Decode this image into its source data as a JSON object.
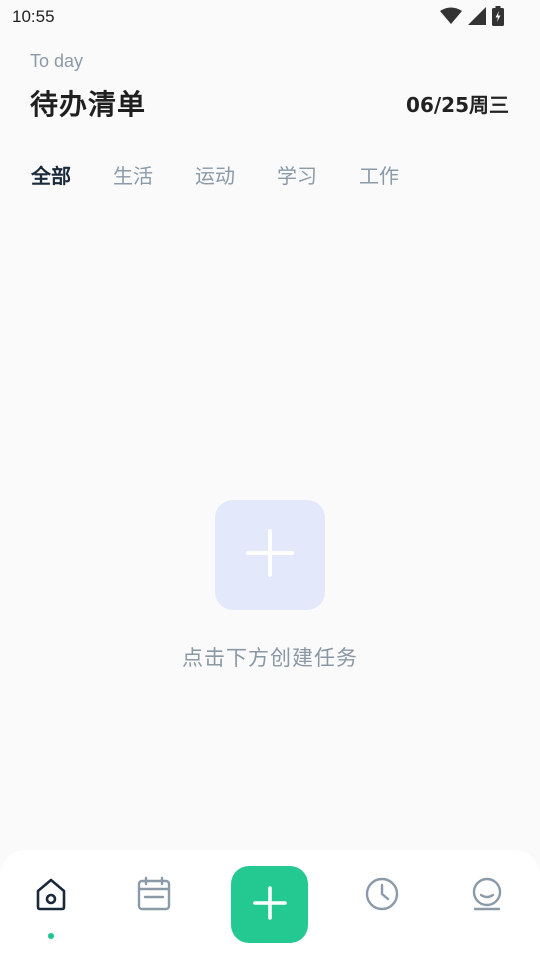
{
  "status_bar": {
    "time": "10:55",
    "icons": [
      "wifi-icon",
      "signal-icon",
      "battery-icon"
    ]
  },
  "header": {
    "subtitle": "To day",
    "title": "待办清单",
    "date": "06/25周三"
  },
  "tabs": [
    {
      "label": "全部",
      "active": true
    },
    {
      "label": "生活",
      "active": false
    },
    {
      "label": "运动",
      "active": false
    },
    {
      "label": "学习",
      "active": false
    },
    {
      "label": "工作",
      "active": false
    }
  ],
  "empty_state": {
    "icon": "plus-icon",
    "message": "点击下方创建任务"
  },
  "bottom_nav": {
    "items": [
      {
        "icon": "home-icon",
        "active": true
      },
      {
        "icon": "calendar-icon",
        "active": false
      },
      {
        "icon": "plus-icon",
        "primary": true
      },
      {
        "icon": "clock-icon",
        "active": false
      },
      {
        "icon": "profile-icon",
        "active": false
      }
    ]
  },
  "colors": {
    "accent": "#23c990",
    "empty_tile": "#e3e9fb",
    "muted_text": "#8a9aa8",
    "active_icon": "#1a2a3a"
  }
}
